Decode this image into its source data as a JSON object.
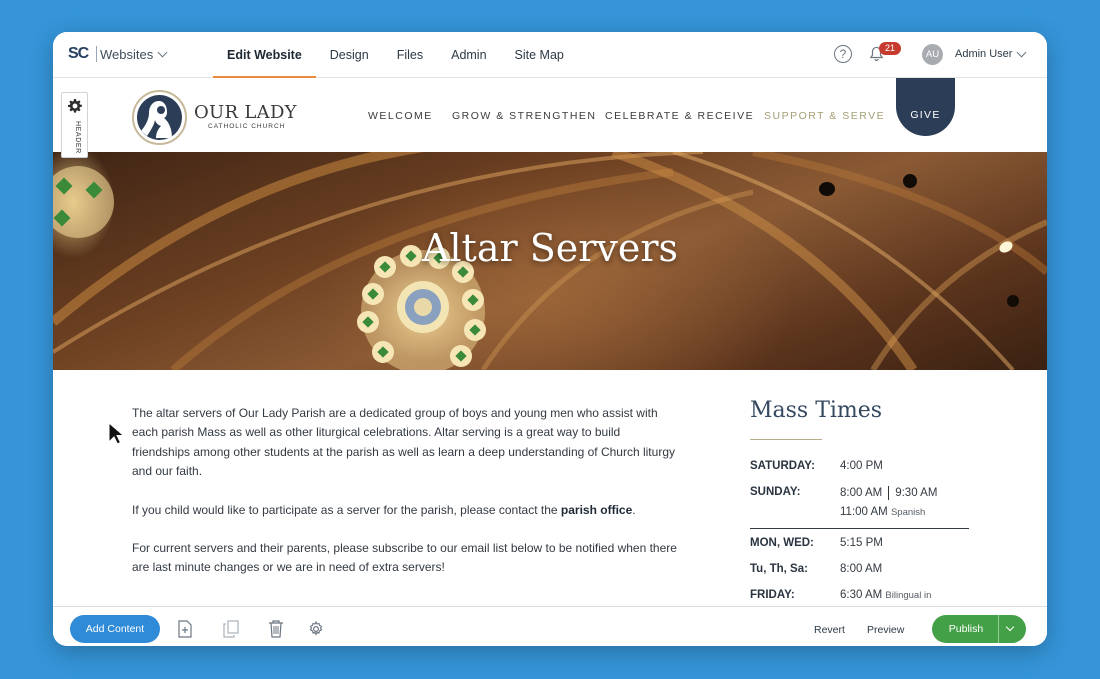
{
  "cms": {
    "logo": "SC",
    "sites_label": "Websites",
    "tabs": [
      {
        "label": "Edit Website",
        "active": true
      },
      {
        "label": "Design",
        "active": false
      },
      {
        "label": "Files",
        "active": false
      },
      {
        "label": "Admin",
        "active": false
      },
      {
        "label": "Site Map",
        "active": false
      }
    ],
    "help_label": "?",
    "notification_count": "21",
    "user_initials": "AU",
    "user_name": "Admin User",
    "accent": "#e88b3a"
  },
  "site": {
    "header_handle_label": "HEADER",
    "church_name": "OUR LADY",
    "church_subtitle": "CATHOLIC CHURCH",
    "nav": [
      "WELCOME",
      "GROW & STRENGTHEN",
      "CELEBRATE & RECEIVE",
      "SUPPORT & SERVE"
    ],
    "give_label": "GIVE",
    "brand_navy": "#2c3e57",
    "brand_gold": "#a49f74"
  },
  "hero": {
    "title": "Altar Servers"
  },
  "content": {
    "para1": "The altar servers of Our Lady Parish are a dedicated group of boys and young men who assist with each parish Mass as well as other liturgical celebrations. Altar serving is a great way to build friendships among other students at the parish as well as learn a deep understanding of Church liturgy and our faith.",
    "para2_prefix": "If you child would like to participate as a server for the parish, please contact the ",
    "para2_link": "parish office",
    "para2_suffix": ".",
    "para3": "For current servers and their parents, please subscribe to our email list below to be notified when there are last minute changes or we are in need of extra servers!"
  },
  "mass_times": {
    "title": "Mass Times",
    "saturday_day": "SATURDAY:",
    "saturday_time": "4:00 PM",
    "sunday_day": "SUNDAY:",
    "sunday_time1": "8:00 AM",
    "sunday_time2": "9:30 AM",
    "sunday_time3": "11:00 AM",
    "sunday_note": "Spanish",
    "monwed_day": "MON, WED:",
    "monwed_time": "5:15 PM",
    "tuthsa_day": "Tu, Th, Sa:",
    "tuthsa_time": "8:00 AM",
    "friday_day": "FRIDAY:",
    "friday_time": "6:30 AM",
    "friday_note": "Bilingual in"
  },
  "toolbar": {
    "add_content": "Add Content",
    "icons": [
      "add-page-icon",
      "duplicate-icon",
      "trash-icon",
      "settings-gear-icon"
    ],
    "revert": "Revert",
    "preview": "Preview",
    "publish": "Publish",
    "publish_color": "#43a047",
    "add_color": "#2f8ad8"
  }
}
